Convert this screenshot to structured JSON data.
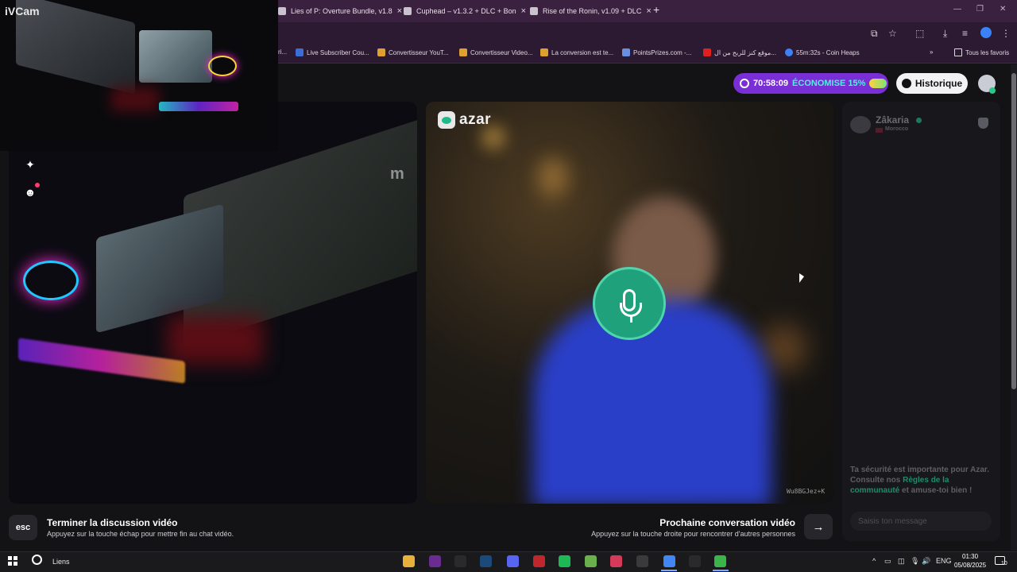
{
  "browser": {
    "tabs": [
      {
        "label": "Lies of P: Overture Bundle, v1.8"
      },
      {
        "label": "Cuphead – v1.3.2 + DLC + Bon"
      },
      {
        "label": "Rise of the Ronin, v1.09 + DLC"
      }
    ],
    "bookmarks": [
      {
        "label": "ri...",
        "color": "#7a7a7a"
      },
      {
        "label": "Live Subscriber Cou...",
        "color": "#3b6fd6"
      },
      {
        "label": "Convertisseur YouT...",
        "color": "#e0a030"
      },
      {
        "label": "Convertisseur Video...",
        "color": "#e0a030"
      },
      {
        "label": "La conversion est te...",
        "color": "#e0a030"
      },
      {
        "label": "PointsPrizes.com -...",
        "color": "#6a8ee0"
      },
      {
        "label": "موقع كنز للربح من ال...",
        "color": "#e02020"
      },
      {
        "label": "55m:32s - Coin Heaps",
        "color": "#3b82f6"
      }
    ],
    "all_bookmarks_label": "Tous les favoris"
  },
  "header": {
    "timer": "70:58:09",
    "savings": "ÉCONOMISE 15%",
    "history_label": "Historique"
  },
  "camera": {
    "app_label": "iVCam",
    "watermark": "m"
  },
  "remote": {
    "brand": "azar",
    "video_id": "Wu8BGJez+K"
  },
  "chat": {
    "partner_name": "Zâkaria",
    "partner_country": "Morocco",
    "safety_text_1": "Ta sécurité est importante pour Azar. Consulte nos ",
    "safety_link": "Règles de la communauté",
    "safety_text_2": " et amuse-toi bien !",
    "message_placeholder": "Saisis ton message"
  },
  "footer": {
    "esc_label": "esc",
    "end_title": "Terminer la discussion vidéo",
    "end_sub": "Appuyez sur la touche échap pour mettre fin au chat vidéo.",
    "next_title": "Prochaine conversation vidéo",
    "next_sub": "Appuyez sur la touche droite pour rencontrer d'autres personnes",
    "next_arrow": "→"
  },
  "taskbar": {
    "search_label": "Liens",
    "apps": [
      {
        "name": "file-explorer",
        "color": "#e8b23a"
      },
      {
        "name": "visual-studio",
        "color": "#6a2c91"
      },
      {
        "name": "epic-games",
        "color": "#2a2a2a"
      },
      {
        "name": "steam",
        "color": "#1b4a7a"
      },
      {
        "name": "discord",
        "color": "#5865f2"
      },
      {
        "name": "app-red",
        "color": "#c0272d"
      },
      {
        "name": "spotify",
        "color": "#1db954"
      },
      {
        "name": "bluestacks",
        "color": "#6ab04c"
      },
      {
        "name": "app-pink",
        "color": "#d63a5a"
      },
      {
        "name": "app-roblox",
        "color": "#3a3a3a"
      },
      {
        "name": "chrome",
        "color": "#4285f4"
      },
      {
        "name": "app-dark",
        "color": "#2a2a2a"
      },
      {
        "name": "app-green",
        "color": "#3bb54a"
      }
    ],
    "language": "ENG",
    "time": "01:30",
    "date": "05/08/2025",
    "notifications": "10"
  }
}
